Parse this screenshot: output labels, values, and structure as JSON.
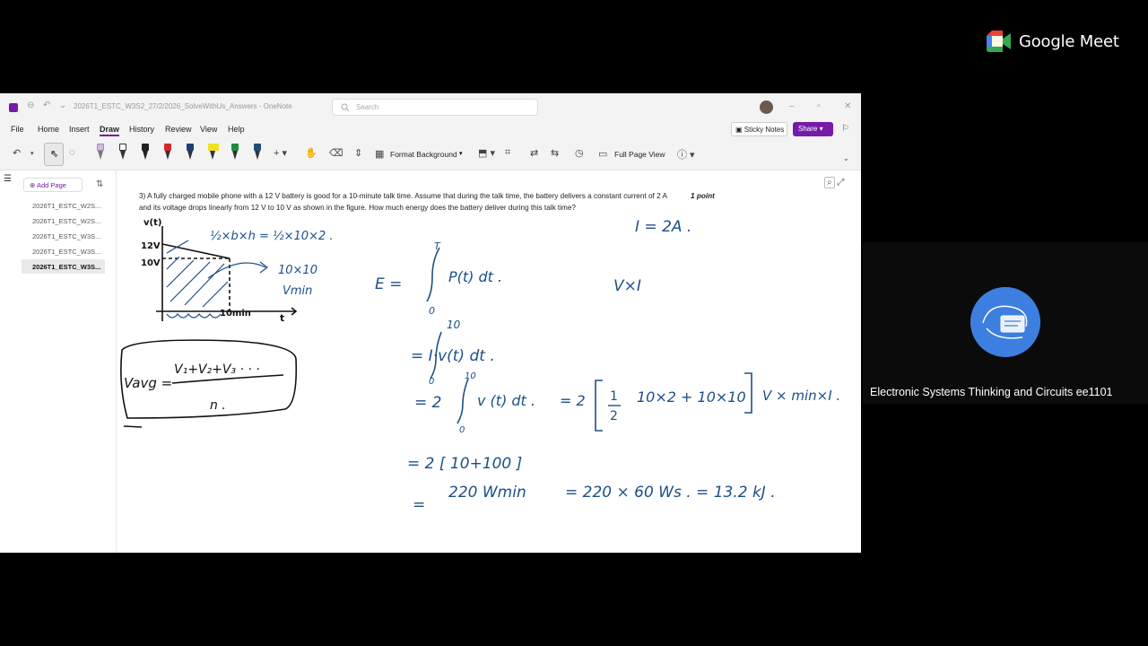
{
  "meet": {
    "brand": "Google Meet",
    "participant_name": "Electronic Systems Thinking and Circuits ee1101"
  },
  "window": {
    "doc_title": "2026T1_ESTC_W3S2_27/2/2026_SolveWithUs_Answers  -  OneNote",
    "search_placeholder": "Search"
  },
  "menu": {
    "items": [
      "File",
      "Home",
      "Insert",
      "Draw",
      "History",
      "Review",
      "View",
      "Help"
    ],
    "active": "Draw",
    "sticky_notes": "Sticky Notes",
    "share": "Share"
  },
  "ribbon": {
    "format_background": "Format Background",
    "full_page_view": "Full Page View",
    "pen_colors": [
      "#8a8a8a",
      "#222222",
      "#d22a2a",
      "#1c3f7a",
      "#f0e020",
      "#1f8a3a",
      "#1c4f7a"
    ]
  },
  "pages": {
    "add_page": "Add Page",
    "items": [
      "2026T1_ESTC_W2S...",
      "2026T1_ESTC_W2S...",
      "2026T1_ESTC_W3S...",
      "2026T1_ESTC_W3S...",
      "2026T1_ESTC_W3S..."
    ],
    "selected_index": 4
  },
  "question": {
    "line1": "3)  A fully charged mobile phone with a 12 V battery is good for a 10-minute talk time. Assume that during the talk time, the battery delivers a constant current of 2 A",
    "line2": "and its voltage drops linearly from 12 V to 10 V as shown in the figure. How much energy does the battery deliver during this talk time?",
    "points": "1 point"
  },
  "figure": {
    "y_label": "v(t)",
    "v12": "12V",
    "v10": "10V",
    "t_label": "t",
    "t_end": "10min"
  },
  "handwriting": {
    "area_formula": "½×b×h = ½×10×2 .",
    "rect": "10×10",
    "rect_unit": "Vmin",
    "vavg_lhs": "Vavg =",
    "vavg_num": "V₁+V₂+V₃ ·  ·  ·",
    "vavg_den": "n .",
    "current": "I = 2A .",
    "vxi": "V×I",
    "e_eq": "E  =",
    "integral_p": "P(t) dt .",
    "upper_T": "T",
    "lower_0": "0",
    "limit_10": "10",
    "line2": "=   I·v(t) dt .",
    "line3_a": "=  2",
    "line3_b": "v (t) dt .",
    "line3_c": "= 2",
    "line3_d": "10×2  + 10×10",
    "line3_e": "V × min×I .",
    "line4": "= 2 [ 10+100 ]",
    "line5_a": "=",
    "line5_b": "220   Wmin",
    "line5_c": "= 220 × 60   Ws .  = 13.2 kJ ."
  }
}
